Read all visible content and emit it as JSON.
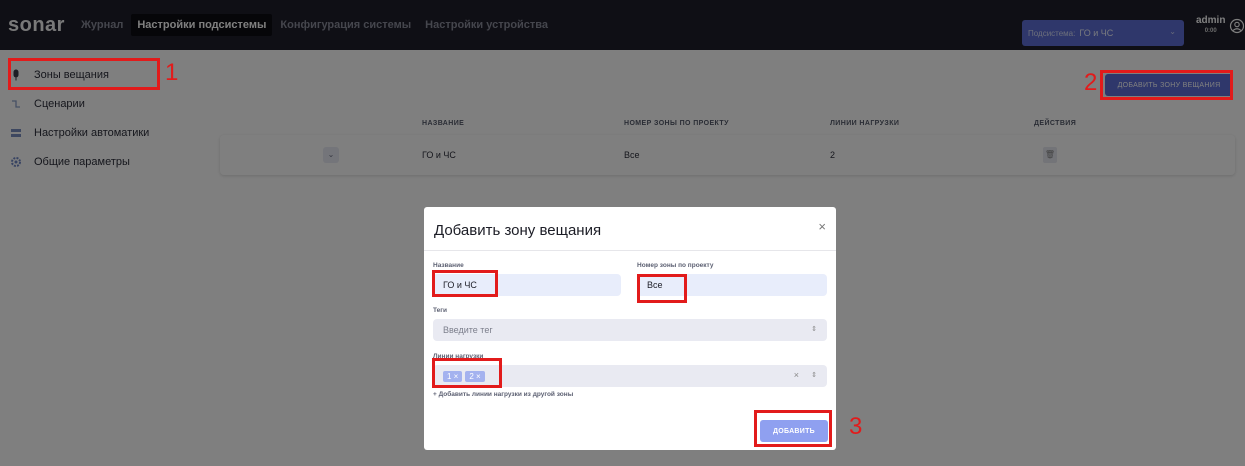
{
  "app": {
    "logo": "sonar",
    "nav": [
      "Журнал",
      "Настройки подсистемы",
      "Конфигурация системы",
      "Настройки устройства"
    ],
    "active_nav": 1
  },
  "subsystem": {
    "label": "Подсистема:",
    "value": "ГО и ЧС",
    "arrow": "⌄"
  },
  "user": {
    "name": "admin",
    "time": "0:00"
  },
  "sidebar": {
    "items": [
      {
        "label": "Зоны вещания",
        "icon": "mic-icon"
      },
      {
        "label": "Сценарии",
        "icon": "scenario-icon"
      },
      {
        "label": "Настройки автоматики",
        "icon": "automation-icon"
      },
      {
        "label": "Общие параметры",
        "icon": "settings-icon"
      }
    ]
  },
  "main": {
    "add_button": "ДОБАВИТЬ ЗОНУ ВЕЩАНИЯ",
    "columns": [
      "НАЗВАНИЕ",
      "НОМЕР ЗОНЫ ПО ПРОЕКТУ",
      "ЛИНИИ НАГРУЗКИ",
      "ДЕЙСТВИЯ"
    ],
    "rows": [
      {
        "expand": "⌄",
        "name": "ГО и ЧС",
        "zone_number": "Все",
        "lines": "2",
        "delete": "🗑"
      }
    ]
  },
  "modal": {
    "title": "Добавить зону вещания",
    "close": "×",
    "name_label": "Название",
    "name_value": "ГО и ЧС",
    "zone_label": "Номер зоны по проекту",
    "zone_value": "Все",
    "tags_label": "Теги",
    "tags_placeholder": "Введите тег",
    "lines_label": "Линии нагрузки",
    "line_chips": [
      "1 ×",
      "2 ×"
    ],
    "clear": "×",
    "arrows": "⇕",
    "add_from_other": "+ Добавить линии нагрузки из другой зоны",
    "submit": "ДОБАВИТЬ"
  },
  "annotations": [
    "1",
    "2",
    "3"
  ]
}
